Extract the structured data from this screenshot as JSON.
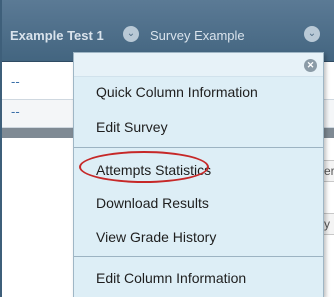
{
  "grade_center": {
    "columns": [
      {
        "label": "Example Test 1"
      },
      {
        "label": "Survey Example"
      }
    ],
    "rows": [
      {
        "value": "--"
      },
      {
        "value": "--"
      }
    ],
    "edge_glyphs": [
      "er",
      "y"
    ]
  },
  "context_menu": {
    "close_icon_glyph": "✕",
    "items": [
      {
        "label": "Quick Column Information"
      },
      {
        "label": "Edit Survey"
      },
      {
        "label": "Attempts Statistics",
        "highlighted": true
      },
      {
        "label": "Download Results"
      },
      {
        "label": "View Grade History"
      },
      {
        "label": "Edit Column Information"
      }
    ]
  },
  "icons": {
    "header_chevron": "chevron-down-icon",
    "menu_close": "close-icon"
  },
  "colors": {
    "header_bar": "#4f6f8a",
    "menu_background": "#ddeef6",
    "highlight": "#c62828",
    "link_text": "#3a6fa8"
  }
}
